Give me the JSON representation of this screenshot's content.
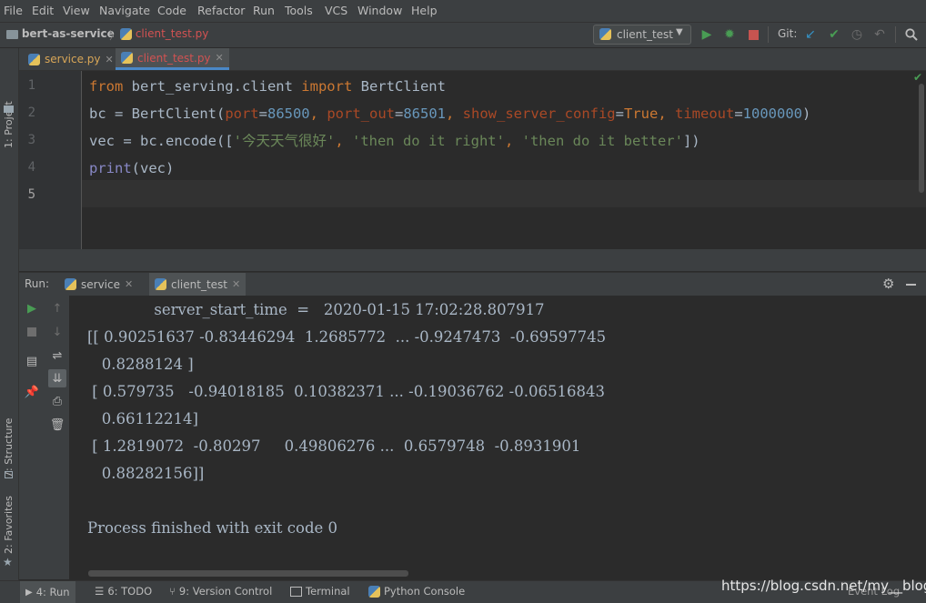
{
  "menu": [
    "File",
    "Edit",
    "View",
    "Navigate",
    "Code",
    "Refactor",
    "Run",
    "Tools",
    "VCS",
    "Window",
    "Help"
  ],
  "breadcrumb": {
    "project": "bert-as-service",
    "file": "client_test.py"
  },
  "run_config": "client_test",
  "git_label": "Git:",
  "left_stripe": {
    "project": "1: Project",
    "structure": "7: Structure",
    "favorites": "2: Favorites"
  },
  "tabs": [
    {
      "label": "service.py"
    },
    {
      "label": "client_test.py"
    }
  ],
  "editor": {
    "line_numbers": [
      "1",
      "2",
      "3",
      "4",
      "5"
    ],
    "line1": {
      "kw1": "from",
      "mod": " bert_serving.client ",
      "kw2": "import",
      "cls": " BertClient"
    },
    "line2": {
      "a": "bc = BertClient(",
      "p1": "port",
      "e1": "=",
      "n1": "86500",
      ", ": ", ",
      "p2": "port_out",
      "e2": "=",
      "n2": "86501",
      "c2": ", ",
      "p3": "show_server_config",
      "e3": "=",
      "v3": "True",
      "c3": ", ",
      "p4": "timeout",
      "e4": "=",
      "n4": "1000000",
      "end": ")"
    },
    "line3": {
      "a": "vec = bc.encode([",
      "s1": "'今天天气很好'",
      "c1": ", ",
      "s2": "'then do it right'",
      "c2": ", ",
      "s3": "'then do it better'",
      "end": "])"
    },
    "line4": {
      "fn": "print",
      "rest": "(vec)"
    }
  },
  "run_panel": {
    "label": "Run:",
    "tabs": [
      {
        "label": "service"
      },
      {
        "label": "client_test"
      }
    ],
    "output": [
      "              server_start_time  =   2020-01-15 17:02:28.807917",
      "[[ 0.90251637 -0.83446294  1.2685772  ... -0.9247473  -0.69597745",
      "   0.8288124 ]",
      " [ 0.579735   -0.94018185  0.10382371 ... -0.19036762 -0.06516843",
      "   0.66112214]",
      " [ 1.2819072  -0.80297     0.49806276 ...  0.6579748  -0.8931901",
      "   0.88282156]]",
      "",
      "Process finished with exit code 0"
    ]
  },
  "statusbar": {
    "run": "4: Run",
    "todo": "6: TODO",
    "vcs": "9: Version Control",
    "terminal": "Terminal",
    "python_console": "Python Console",
    "event_log": "Event Log",
    "watermark": "https://blog.csdn.net/my__blog"
  },
  "colors": {
    "keyword": "#cc7832",
    "number": "#6897bb",
    "param": "#aa4926",
    "string": "#6a8759",
    "builtin": "#8888c6",
    "text": "#a9b7c6",
    "run_green": "#499c54",
    "stop_red": "#c75450"
  }
}
